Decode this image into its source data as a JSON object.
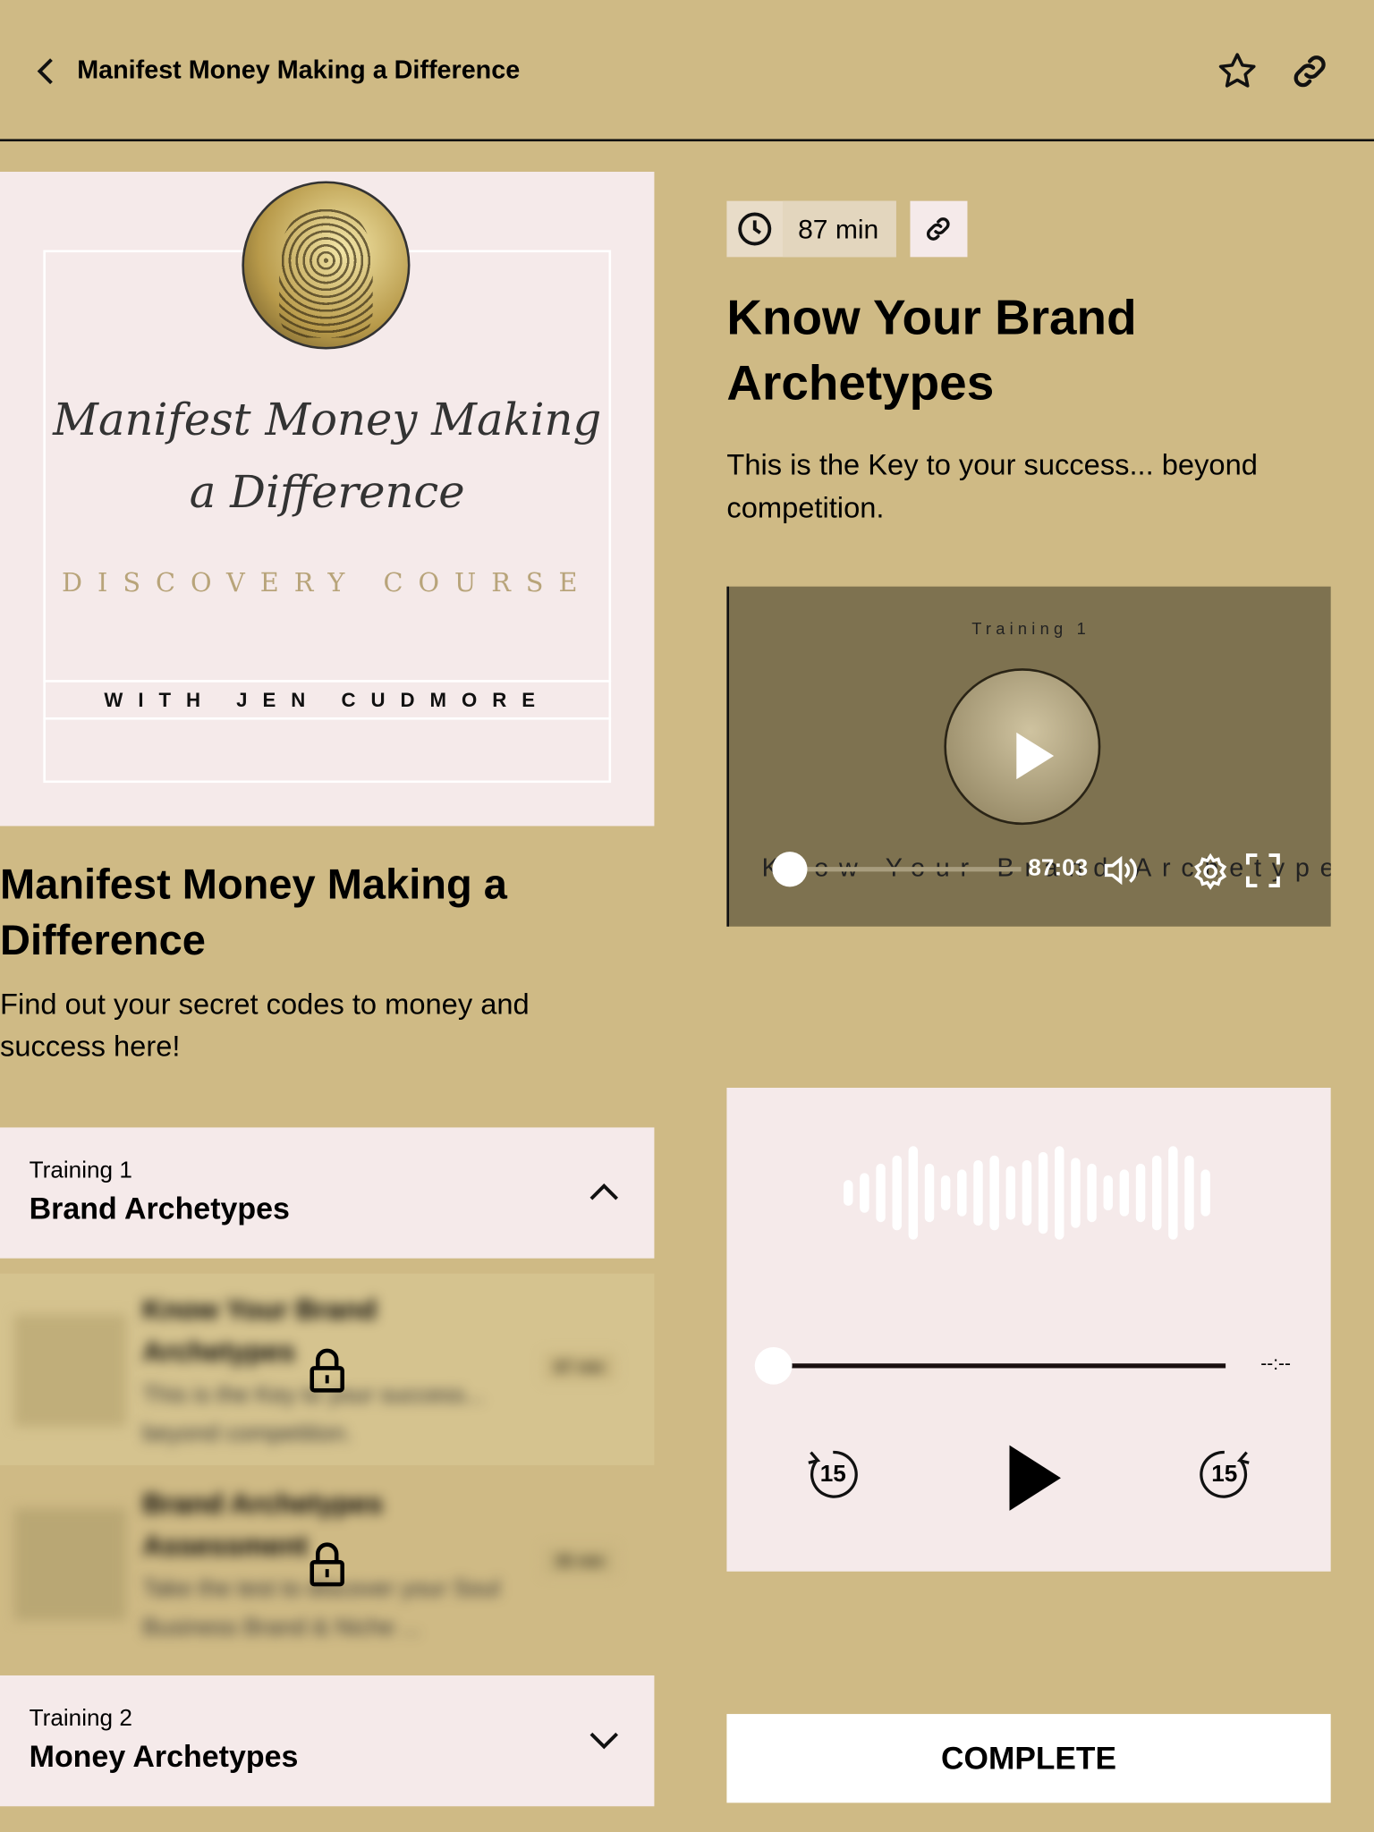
{
  "header": {
    "title": "Manifest Money Making a Difference",
    "back_icon": "chevron-left-icon",
    "favorite_icon": "star-icon",
    "share_icon": "link-icon"
  },
  "cover": {
    "script_line1": "Manifest Money Making",
    "script_line2": "a Difference",
    "subtitle": "DISCOVERY COURSE",
    "author": "WITH JEN CUDMORE"
  },
  "course": {
    "title": "Manifest Money Making a Difference",
    "description": "Find out your secret codes to money and success here!"
  },
  "sections": [
    {
      "label": "Training 1",
      "title": "Brand Archetypes",
      "expanded": true,
      "lessons": [
        {
          "title": "Know Your Brand Archetypes",
          "description": "This is the Key to your success... beyond competition.",
          "duration": "87 min",
          "locked": true
        },
        {
          "title": "Brand Archetypes Assessment",
          "description": "Take the test to discover your Soul Business Brand & Niche ...",
          "duration": "35 min",
          "locked": true
        }
      ]
    },
    {
      "label": "Training 2",
      "title": "Money Archetypes",
      "expanded": false
    }
  ],
  "lesson": {
    "duration": "87 min",
    "title_line1": "Know Your Brand",
    "title_line2": "Archetypes",
    "description": "This is the Key to your success... beyond competition."
  },
  "video": {
    "overlay_top": "Training 1",
    "overlay_bottom": "Know Your Brand Archetypes",
    "time": "87:03",
    "progress": 0
  },
  "audio": {
    "time": "--:--",
    "skip_back": "15",
    "skip_forward": "15",
    "progress": 0
  },
  "complete_label": "COMPLETE",
  "colors": {
    "background": "#cfba85",
    "card": "#f5eaea",
    "video": "#7e7250"
  }
}
